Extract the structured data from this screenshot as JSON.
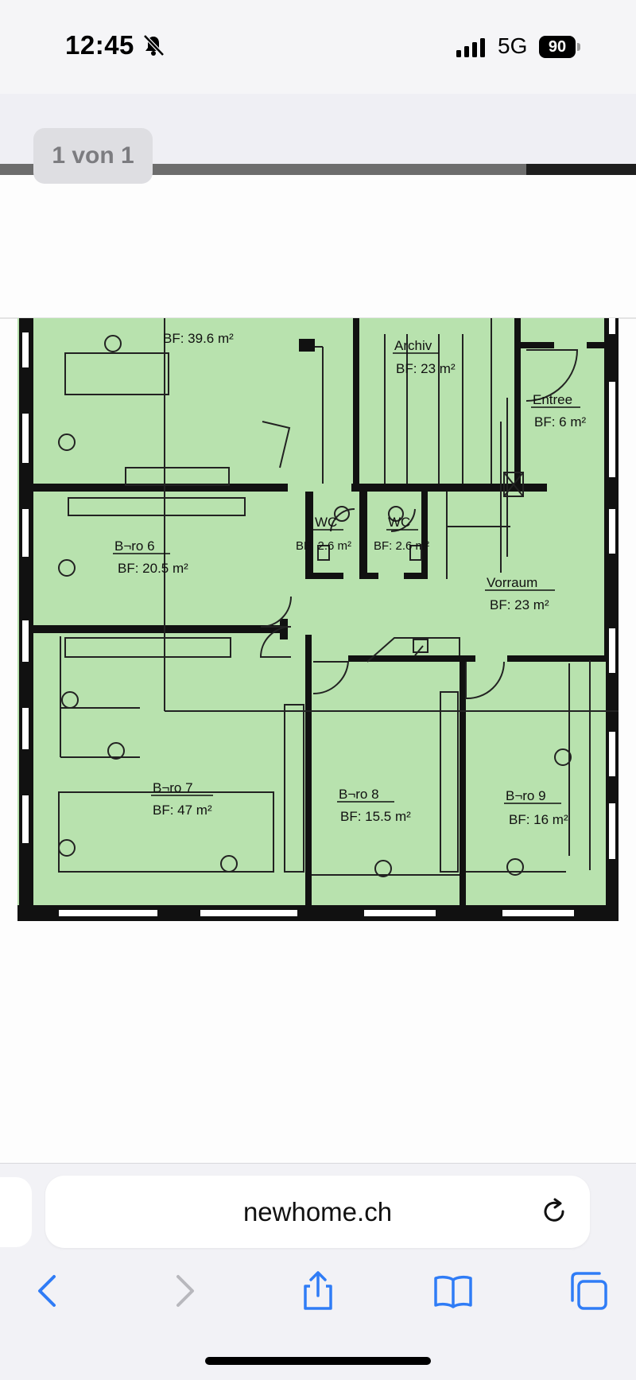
{
  "status": {
    "time": "12:45",
    "network": "5G",
    "battery": "90"
  },
  "pdf": {
    "page_counter": "1 von 1"
  },
  "plan": {
    "rooms": [
      {
        "name": "",
        "area": "BF: 39.6 m²"
      },
      {
        "name": "Archiv",
        "area": "BF: 23 m²"
      },
      {
        "name": "Entree",
        "area": "BF: 6 m²"
      },
      {
        "name": "WC",
        "area": "BF: 2.6 m²"
      },
      {
        "name": "WC",
        "area": "BF: 2.6 m²"
      },
      {
        "name": "B¬ro 6",
        "area": "BF: 20.5 m²"
      },
      {
        "name": "Vorraum",
        "area": "BF: 23 m²"
      },
      {
        "name": "B¬ro 7",
        "area": "BF: 47 m²"
      },
      {
        "name": "B¬ro 8",
        "area": "BF: 15.5 m²"
      },
      {
        "name": "B¬ro 9",
        "area": "BF: 16 m²"
      }
    ]
  },
  "browser": {
    "domain": "newhome.ch",
    "accent": "#2f7cf6"
  },
  "icons": {
    "bell": "bell-slash-icon",
    "reload": "reload-icon",
    "back": "chevron-left-icon",
    "forward": "chevron-right-icon",
    "share": "share-icon",
    "bookmarks": "book-icon",
    "tabs": "tabs-icon"
  },
  "colors": {
    "plan_fill": "#b8e2ae",
    "wall": "#111111"
  }
}
